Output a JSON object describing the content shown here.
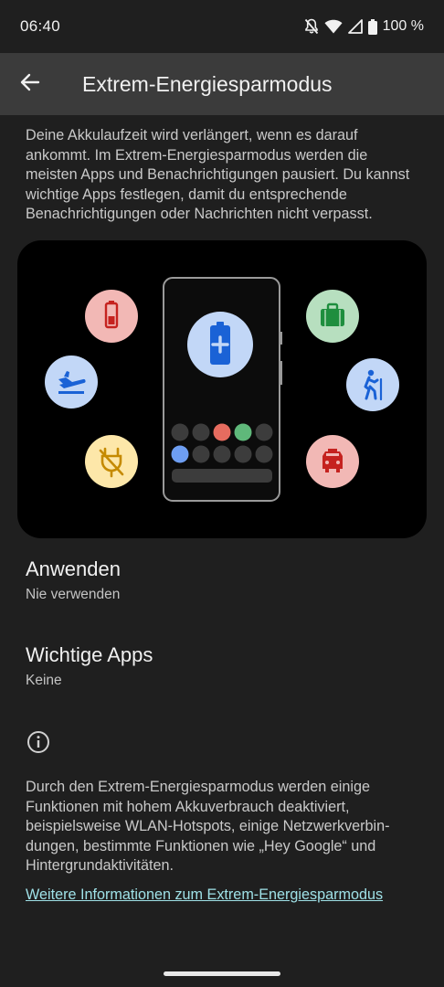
{
  "status_bar": {
    "time": "06:40",
    "battery_percent": "100 %",
    "icons": [
      "notifications-off-icon",
      "wifi-icon",
      "signal-icon",
      "battery-full-icon"
    ]
  },
  "app_bar": {
    "title": "Extrem-Energiesparmodus",
    "back_icon": "arrow-back-icon"
  },
  "description": "Deine Akkulaufzeit wird verlängert, wenn es darauf ankommt. Im Extrem-Energiesparmodus werden die meisten Apps und Benachrichtigungen pausiert. Du kannst wichtige Apps festlegen, damit du entsprechende Benachrichtigungen oder Nachrichten nicht verpasst.",
  "illustration": {
    "bubbles": [
      {
        "icon": "battery-low-icon",
        "color": "#f2b8b5"
      },
      {
        "icon": "airplane-icon",
        "color": "#c2d7f7"
      },
      {
        "icon": "power-off-icon",
        "color": "#fde7a9"
      },
      {
        "icon": "briefcase-icon",
        "color": "#b7dfbf"
      },
      {
        "icon": "hiking-icon",
        "color": "#c2d7f7"
      },
      {
        "icon": "taxi-icon",
        "color": "#f2b8b5"
      },
      {
        "icon": "battery-plus-icon",
        "color": "#c2d7f7"
      }
    ],
    "dot_colors": [
      "#3c3c3c",
      "#3c3c3c",
      "#e66c5f",
      "#5fb87a",
      "#3c3c3c",
      "#6e9ef2",
      "#3c3c3c",
      "#3c3c3c",
      "#3c3c3c",
      "#3c3c3c"
    ]
  },
  "settings": [
    {
      "title": "Anwenden",
      "subtitle": "Nie verwenden"
    },
    {
      "title": "Wichtige Apps",
      "subtitle": "Keine"
    }
  ],
  "footer": {
    "info_icon": "info-icon",
    "text": "Durch den Extrem-Energiesparmodus werden einige Funktionen mit hohem Akkuverbrauch deaktiviert, beispielsweise WLAN-Hotspots, einige Netzwerkverbin­dungen, bestimmte Funktionen wie „Hey Google“ und Hintergrundaktivitäten.",
    "link": "Weitere Informationen zum Extrem-Energiesparmodus"
  }
}
